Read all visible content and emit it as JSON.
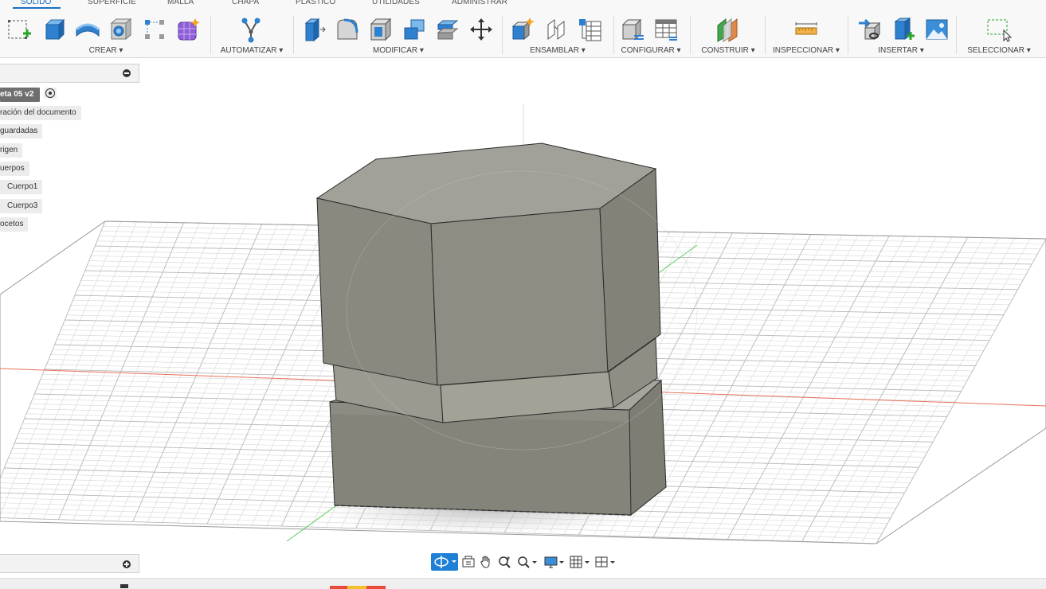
{
  "tabs": [
    "SÓLIDO",
    "SUPERFICIE",
    "MALLA",
    "CHAPA",
    "PLÁSTICO",
    "UTILIDADES",
    "ADMINISTRAR"
  ],
  "groups": {
    "crear": "CREAR ▾",
    "automatizar": "AUTOMATIZAR ▾",
    "modificar": "MODIFICAR ▾",
    "ensamblar": "ENSAMBLAR ▾",
    "configurar": "CONFIGURAR ▾",
    "construir": "CONSTRUIR ▾",
    "inspeccionar": "INSPECCIONAR ▾",
    "insertar": "INSERTAR ▾",
    "seleccionar": "SELECCIONAR ▾"
  },
  "browser": {
    "root": "eta 05 v2",
    "items": [
      "ración del documento",
      "guardadas",
      "rigen",
      "uerpos",
      "Cuerpo1",
      "Cuerpo3",
      "ocetos"
    ]
  },
  "colors": {
    "accent": "#1b6fc2",
    "x_axis": "#e8705a",
    "y_axis": "#5bcf5b",
    "body_face": "#8e8d83"
  },
  "icons": {
    "create": [
      "sketch-icon",
      "extrude-icon",
      "revolve-icon",
      "hole-icon",
      "pattern-icon",
      "form-icon"
    ],
    "automate": [
      "automate-icon"
    ],
    "modify": [
      "press-pull-icon",
      "fillet-icon",
      "shell-icon",
      "combine-icon",
      "split-icon",
      "move-icon"
    ],
    "assemble": [
      "new-component-icon",
      "joint-icon",
      "bom-icon"
    ],
    "configure": [
      "configure-icon",
      "table-icon"
    ],
    "construct": [
      "offset-plane-icon"
    ],
    "inspect": [
      "measure-icon"
    ],
    "insert": [
      "insert-link-icon",
      "insert-component-icon",
      "insert-image-icon"
    ],
    "select": [
      "select-window-icon"
    ]
  }
}
